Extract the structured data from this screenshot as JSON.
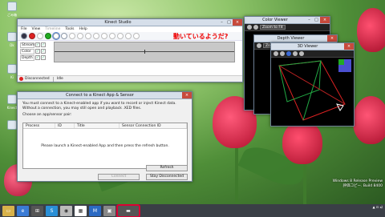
{
  "desktop": {
    "icons": [
      {
        "label": "ごみ箱",
        "icon": "recycle-bin-icon"
      },
      {
        "label": "Dk",
        "icon": "app-icon"
      },
      {
        "label": "Ki",
        "icon": "app-icon"
      },
      {
        "label": "Kinect",
        "icon": "app-icon"
      },
      {
        "label": "",
        "icon": "app-icon"
      }
    ],
    "watermark": {
      "line1": "Windows 8 Release Preview",
      "line2": "評価コピー. Build 8400"
    }
  },
  "studio": {
    "title": "Kinect Studio",
    "menu": [
      "File",
      "View",
      "Timeline",
      "Tools",
      "Help"
    ],
    "annotation": "動いているようだ?",
    "tracks": [
      {
        "label": "Stream"
      },
      {
        "label": "Color"
      },
      {
        "label": "Depth"
      }
    ],
    "status": {
      "connection": "Disconnected",
      "state": "Idle"
    }
  },
  "color_viewer": {
    "title": "Color Viewer",
    "zoom_label": "Zoom to Fit"
  },
  "depth_viewer": {
    "title": "Depth Viewer",
    "zoom_label": "Zoom to Fit"
  },
  "viewer3d": {
    "title": "3D Viewer"
  },
  "connect": {
    "title": "Connect to a Kinect App & Sensor",
    "text1": "You must connect to a Kinect-enabled app if you want to record or inject Kinect data.",
    "text2": "Without a connection, you may still open and playback .XED files.",
    "prompt": "Choose an app/sensor pair:",
    "columns": [
      "Process",
      "ID",
      "Title",
      "Sensor Connection ID"
    ],
    "empty_message": "Please launch a Kinect-enabled App and then press the refresh button.",
    "refresh_label": "Refresh",
    "connect_label": "Connect",
    "stay_label": "Stay Disconnected"
  },
  "taskbar": {
    "apps": [
      "windows-explorer-icon",
      "ie-icon",
      "windows-flag-icon",
      "skype-icon",
      "disk-icon",
      "store-icon",
      "media-icon",
      "app-icon",
      "kinect-studio-icon"
    ]
  }
}
